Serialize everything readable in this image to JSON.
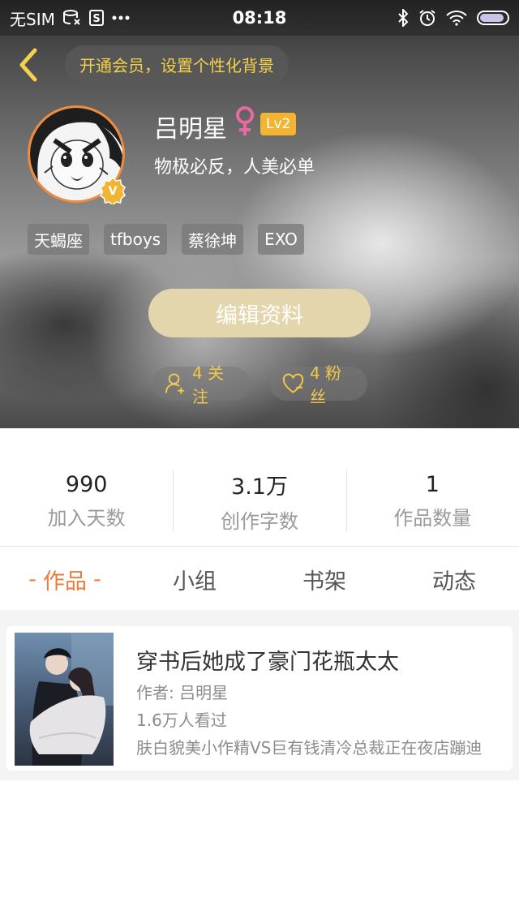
{
  "status_bar": {
    "carrier": "无SIM",
    "time": "08:18",
    "icons": [
      "sim-card-icon",
      "s-app-icon",
      "more-dots-icon",
      "bluetooth-icon",
      "alarm-icon",
      "wifi-icon",
      "battery-icon"
    ],
    "battery_level": 0.9
  },
  "header": {
    "back_icon": "chevron-left-icon",
    "vip_banner": "开通会员，设置个性化背景"
  },
  "profile": {
    "name": "吕明星",
    "gender_icon": "female-icon",
    "level": "Lv2",
    "signature": "物极必反，人美必单",
    "verified_badge": "v-badge-icon",
    "tags": [
      "天蝎座",
      "tfboys",
      "蔡徐坤",
      "EXO"
    ],
    "edit_button": "编辑资料",
    "following_label": "4 关注",
    "fans_label": "4 粉丝"
  },
  "stats": [
    {
      "value": "990",
      "label": "加入天数"
    },
    {
      "value": "3.1万",
      "label": "创作字数"
    },
    {
      "value": "1",
      "label": "作品数量"
    }
  ],
  "tabs": {
    "active_dash": "-",
    "items": [
      {
        "label": "作品",
        "active": true
      },
      {
        "label": "小组",
        "active": false
      },
      {
        "label": "书架",
        "active": false
      },
      {
        "label": "动态",
        "active": false
      }
    ]
  },
  "works": [
    {
      "title": "穿书后她成了豪门花瓶太太",
      "author": "作者: 吕明星",
      "views": "1.6万人看过",
      "description": "肤白貌美小作精VS巨有钱清冷总裁正在夜店蹦迪"
    }
  ],
  "colors": {
    "accent": "#f07a3a",
    "gold": "#f2c84a",
    "level_badge": "#f3b431",
    "edit_button": "#e4d6ac",
    "avatar_border": "#f08b3c"
  }
}
